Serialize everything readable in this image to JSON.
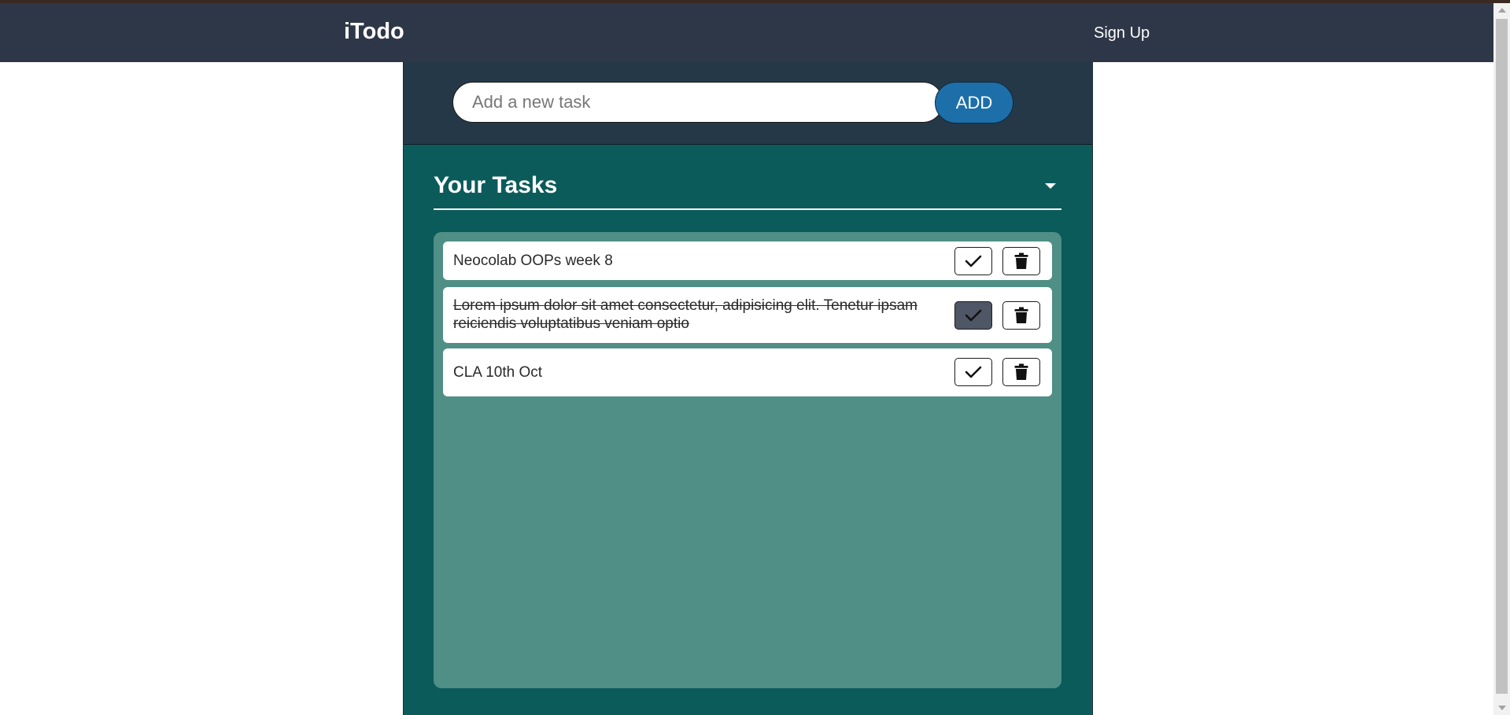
{
  "app": {
    "brand": "iTodo",
    "nav_signup": "Sign Up"
  },
  "input": {
    "placeholder": "Add a new task",
    "value": "",
    "add_label": "ADD"
  },
  "tasks_section": {
    "title": "Your Tasks",
    "items": [
      {
        "text": "Neocolab OOPs week 8",
        "completed": false
      },
      {
        "text": "Lorem ipsum dolor sit amet consectetur, adipisicing elit. Tenetur ipsam reiciendis voluptatibus veniam optio",
        "completed": true
      },
      {
        "text": "CLA 10th Oct",
        "completed": false
      }
    ]
  },
  "colors": {
    "navbar": "#2e3748",
    "input_area": "#253848",
    "panel": "#0c5b5b",
    "task_list": "#4f8f86",
    "add_button": "#1d6fa9",
    "checked_button": "#4f5665"
  },
  "icons": {
    "check": "check-icon",
    "delete": "trash-icon",
    "collapse": "caret-down-icon"
  }
}
